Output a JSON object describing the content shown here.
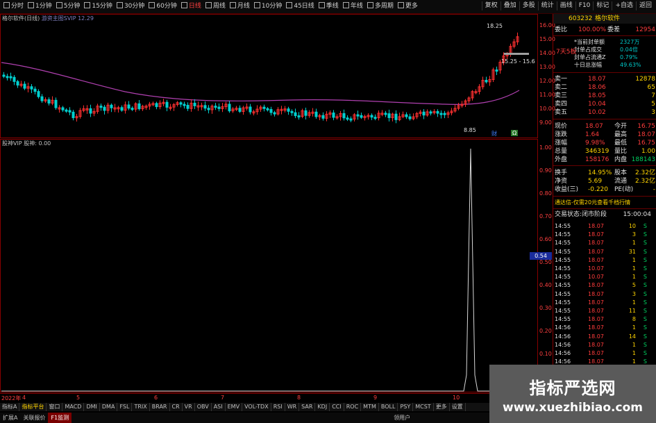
{
  "toolbar": {
    "periods": [
      "分时",
      "1分钟",
      "5分钟",
      "15分钟",
      "30分钟",
      "60分钟",
      "日线",
      "周线",
      "月线",
      "10分钟",
      "45日线",
      "季线",
      "年线",
      "多周期",
      "更多"
    ],
    "active_period": "日线",
    "right_tools": [
      "复权",
      "叠加",
      "多股",
      "统计",
      "画线",
      "F10",
      "标记",
      "+自选",
      "返回"
    ]
  },
  "main_legend": {
    "name": "格尔软件(日线)",
    "indicator": "游资主图SVIP",
    "value": "12.29"
  },
  "price_ticks": [
    "16.00",
    "15.00",
    "14.00",
    "13.00",
    "12.00",
    "11.00",
    "10.00",
    "9.00"
  ],
  "main_annotations": {
    "high": "18.25",
    "range": "15.25 - 15.6",
    "low": "8.85",
    "marker_a": "财",
    "marker_b": "Ω"
  },
  "ind_legend": {
    "name": "股神VIP",
    "label": "股神:",
    "value": "0.00"
  },
  "ind_ticks": [
    "1.00",
    "0.90",
    "0.80",
    "0.70",
    "0.60",
    "0.50",
    "0.40",
    "0.30",
    "0.20",
    "0.10"
  ],
  "ind_current": "0.54",
  "date_ticks": [
    "2022年",
    "4",
    "5",
    "6",
    "7",
    "8",
    "9",
    "10",
    "11"
  ],
  "bottom_tabs": [
    "指标A",
    "指标平台",
    "窗口",
    "MACD",
    "DMI",
    "DMA",
    "FSL",
    "TRIX",
    "BRAR",
    "CR",
    "VR",
    "OBV",
    "ASI",
    "EMV",
    "VOL-TDX",
    "RSI",
    "WR",
    "SAR",
    "KDJ",
    "CCI",
    "ROC",
    "MTM",
    "BOLL",
    "PSY",
    "MCST",
    "更多",
    "设置"
  ],
  "bottom_highlight": [
    "指标平台"
  ],
  "bottom2": [
    {
      "label": "扩展A",
      "active": false
    },
    {
      "label": "关联报价",
      "active": false
    },
    {
      "label": "F1监测",
      "active": true
    },
    {
      "label": "领用户",
      "active": false
    }
  ],
  "info": {
    "code": "603232",
    "name": "格尔软件",
    "wei_bi_label": "委比",
    "wei_bi": "100.00%",
    "wei_cha_label": "委差",
    "wei_cha": "12954",
    "seal_lines": [
      {
        "label": "*当前封单额",
        "value": "2327万"
      },
      {
        "label": "封单占成交",
        "value": "0.04倍"
      },
      {
        "label": "封单占流通Z",
        "value": "0.79%"
      },
      {
        "label": "十日总涨幅",
        "value": "49.63%"
      }
    ],
    "board": "7天5板",
    "sells": [
      {
        "label": "卖一",
        "price": "18.07",
        "vol": "12878"
      },
      {
        "label": "卖二",
        "price": "18.06",
        "vol": "65"
      },
      {
        "label": "卖三",
        "price": "18.05",
        "vol": "7"
      },
      {
        "label": "卖四",
        "price": "10.04",
        "vol": "5"
      },
      {
        "label": "卖五",
        "price": "10.02",
        "vol": "3"
      }
    ],
    "quote": [
      {
        "l1": "现价",
        "v1": "18.07",
        "l2": "今开",
        "v2": "16.75"
      },
      {
        "l1": "涨跌",
        "v1": "1.64",
        "l2": "最高",
        "v2": "18.07"
      },
      {
        "l1": "涨幅",
        "v1": "9.98%",
        "l2": "最低",
        "v2": "16.75"
      },
      {
        "l1": "总量",
        "v1": "346319",
        "l2": "量比",
        "v2": "1.00"
      },
      {
        "l1": "外盘",
        "v1": "158176",
        "l2": "内盘",
        "v2": "188143"
      }
    ],
    "fund": [
      {
        "l1": "换手",
        "v1": "14.95%",
        "l2": "股本",
        "v2": "2.32亿"
      },
      {
        "l1": "净资",
        "v1": "5.69",
        "l2": "流通",
        "v2": "2.32亿"
      },
      {
        "l1": "收益(三)",
        "v1": "-0.220",
        "l2": "PE(动)",
        "v2": "-"
      }
    ],
    "promo": "通达信-仅需20元查看千档行情",
    "status_label": "交易状态:闭市阶段",
    "status_time": "15:00:04",
    "ticks": [
      {
        "t": "14:55",
        "p": "18.07",
        "v": "10",
        "f": "S"
      },
      {
        "t": "14:55",
        "p": "18.07",
        "v": "3",
        "f": "S"
      },
      {
        "t": "14:55",
        "p": "18.07",
        "v": "1",
        "f": "S"
      },
      {
        "t": "14:55",
        "p": "18.07",
        "v": "31",
        "f": "S"
      },
      {
        "t": "14:55",
        "p": "18.07",
        "v": "1",
        "f": "S"
      },
      {
        "t": "14:55",
        "p": "10.07",
        "v": "1",
        "f": "S"
      },
      {
        "t": "14:55",
        "p": "10.07",
        "v": "1",
        "f": "S"
      },
      {
        "t": "14:55",
        "p": "18.07",
        "v": "5",
        "f": "S"
      },
      {
        "t": "14:55",
        "p": "18.07",
        "v": "3",
        "f": "S"
      },
      {
        "t": "14:55",
        "p": "18.07",
        "v": "1",
        "f": "S"
      },
      {
        "t": "14:55",
        "p": "18.07",
        "v": "11",
        "f": "S"
      },
      {
        "t": "14:55",
        "p": "18.07",
        "v": "8",
        "f": "S"
      },
      {
        "t": "14:56",
        "p": "18.07",
        "v": "1",
        "f": "S"
      },
      {
        "t": "14:56",
        "p": "18.07",
        "v": "14",
        "f": "S"
      },
      {
        "t": "14:56",
        "p": "18.07",
        "v": "1",
        "f": "S"
      },
      {
        "t": "14:56",
        "p": "18.07",
        "v": "1",
        "f": "S"
      },
      {
        "t": "14:56",
        "p": "18.07",
        "v": "1",
        "f": "S"
      }
    ]
  },
  "watermark": {
    "line1": "指标严选网",
    "line2": "www.xuezhibiao.com"
  }
}
